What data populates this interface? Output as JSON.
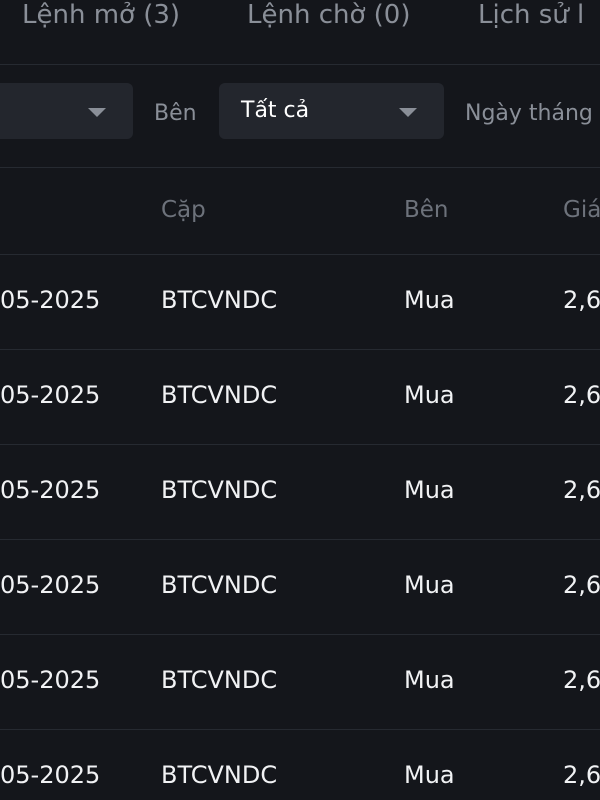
{
  "tabs": [
    {
      "label": "Lệnh mở (3)"
    },
    {
      "label": "Lệnh chờ (0)"
    },
    {
      "label": "Lịch sử l"
    }
  ],
  "filters": {
    "side_label": "Bên",
    "side_value": "Tất cả",
    "date_label": "Ngày tháng"
  },
  "table": {
    "headers": {
      "pair": "Cặp",
      "side": "Bên",
      "price": "Giá"
    },
    "rows": [
      {
        "date": "05-2025",
        "pair": "BTCVNDC",
        "side": "Mua",
        "price": "2,6"
      },
      {
        "date": "05-2025",
        "pair": "BTCVNDC",
        "side": "Mua",
        "price": "2,6"
      },
      {
        "date": "05-2025",
        "pair": "BTCVNDC",
        "side": "Mua",
        "price": "2,6"
      },
      {
        "date": "05-2025",
        "pair": "BTCVNDC",
        "side": "Mua",
        "price": "2,6"
      },
      {
        "date": "05-2025",
        "pair": "BTCVNDC",
        "side": "Mua",
        "price": "2,6"
      },
      {
        "date": "05-2025",
        "pair": "BTCVNDC",
        "side": "Mua",
        "price": "2,6"
      }
    ]
  }
}
